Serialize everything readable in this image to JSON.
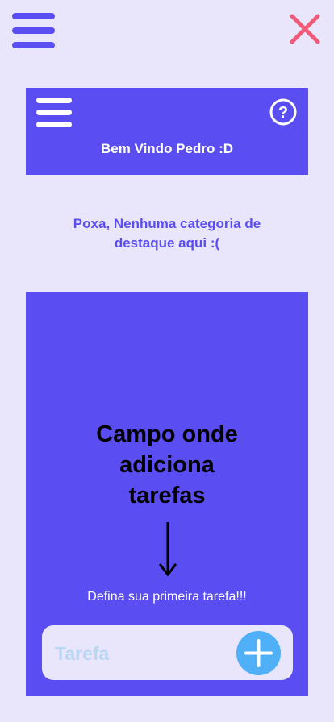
{
  "header": {
    "welcome_text": "Bem Vindo Pedro :D"
  },
  "featured": {
    "empty_message_line1": "Poxa, Nenhuma categoria de",
    "empty_message_line2": "destaque aqui :("
  },
  "task_panel": {
    "caption_lines": [
      "Campo onde",
      "adiciona",
      "tarefas"
    ],
    "first_task_text": "Defina sua primeira tarefa!!!",
    "input_placeholder": "Tarefa"
  },
  "colors": {
    "background": "#e9e6fb",
    "primary": "#5a4ef2",
    "close": "#f25a7a",
    "add_button": "#4fb0f7",
    "placeholder": "#b8d6f4"
  },
  "icons": [
    "menu-icon",
    "close-icon",
    "help-icon",
    "down-arrow-icon",
    "plus-icon"
  ]
}
